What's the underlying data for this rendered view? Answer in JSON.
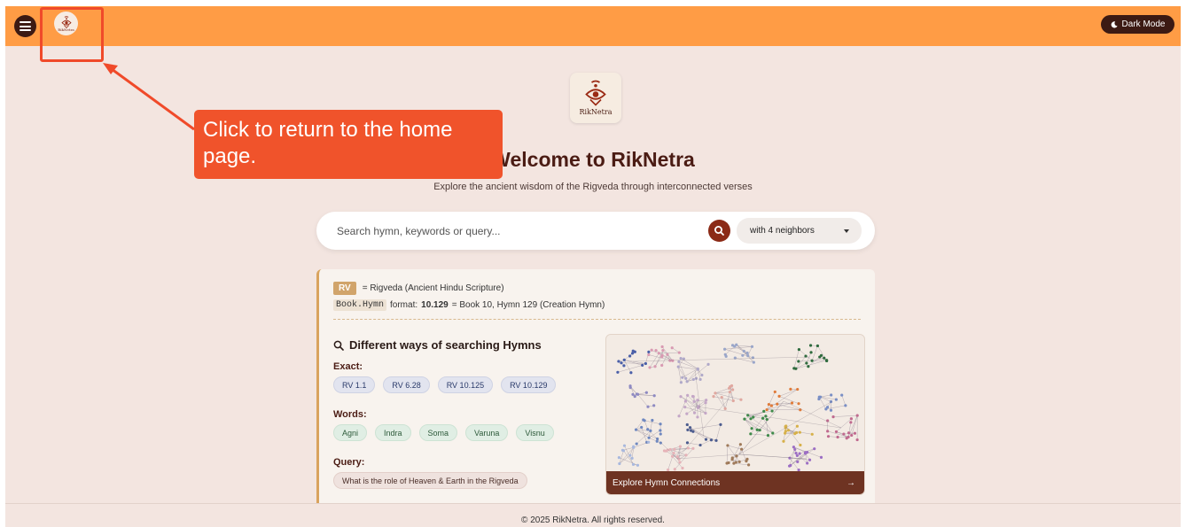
{
  "header": {
    "logo_text": "RikNetra",
    "dark_mode_label": "Dark Mode"
  },
  "hero": {
    "logo_text": "RikNetra",
    "title": "Welcome to RikNetra",
    "subtitle": "Explore the ancient wisdom of the Rigveda through interconnected verses"
  },
  "search": {
    "placeholder": "Search hymn, keywords or query...",
    "neighbors_value": "with 4 neighbors"
  },
  "info": {
    "rv_badge": "RV",
    "rv_desc": "= Rigveda (Ancient Hindu Scripture)",
    "format_code": "Book.Hymn",
    "format_prefix": "format:",
    "format_example": "10.129",
    "format_desc": "= Book 10, Hymn 129 (Creation Hymn)"
  },
  "ways": {
    "title": "Different ways of searching Hymns",
    "exact_label": "Exact:",
    "exact": [
      "RV 1.1",
      "RV 6.28",
      "RV 10.125",
      "RV 10.129"
    ],
    "words_label": "Words:",
    "words": [
      "Agni",
      "Indra",
      "Soma",
      "Varuna",
      "Visnu"
    ],
    "query_label": "Query:",
    "query": [
      "What is the role of Heaven & Earth in the Rigveda"
    ]
  },
  "graph": {
    "label": "Explore Hymn Connections",
    "arrow": "→"
  },
  "footer": {
    "text": "© 2025 RikNetra. All rights reserved."
  },
  "annotation": {
    "callout_text": "Click to return to the home page."
  },
  "colors": {
    "header_bg": "#ff9c45",
    "accent_dark": "#3c1a13",
    "brand_red": "#8b2a16",
    "callout": "#f0532b"
  },
  "icons": {
    "menu": "hamburger-icon",
    "dark_mode": "moon-icon",
    "search": "search-icon",
    "dropdown": "chevron-down-icon",
    "ways": "magnifier-icon",
    "graph_arrow": "arrow-right-icon"
  }
}
